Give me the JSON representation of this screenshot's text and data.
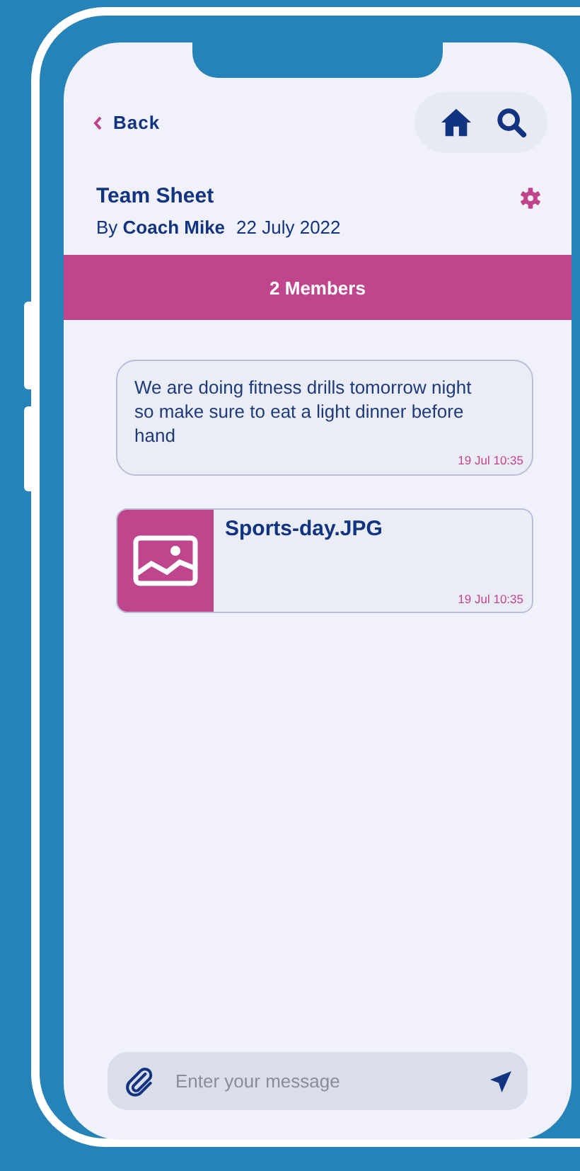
{
  "header": {
    "back_label": "Back",
    "title": "Team Sheet",
    "by_prefix": "By",
    "author": "Coach Mike",
    "date": "22 July 2022"
  },
  "members_bar": {
    "label": "2 Members"
  },
  "messages": [
    {
      "kind": "text",
      "text": "We are doing fitness drills tomorrow night so make sure to eat a light dinner before hand",
      "time": "19 Jul 10:35"
    },
    {
      "kind": "image",
      "file_name": "Sports-day.JPG",
      "time": "19 Jul 10:35"
    }
  ],
  "composer": {
    "placeholder": "Enter your message"
  }
}
